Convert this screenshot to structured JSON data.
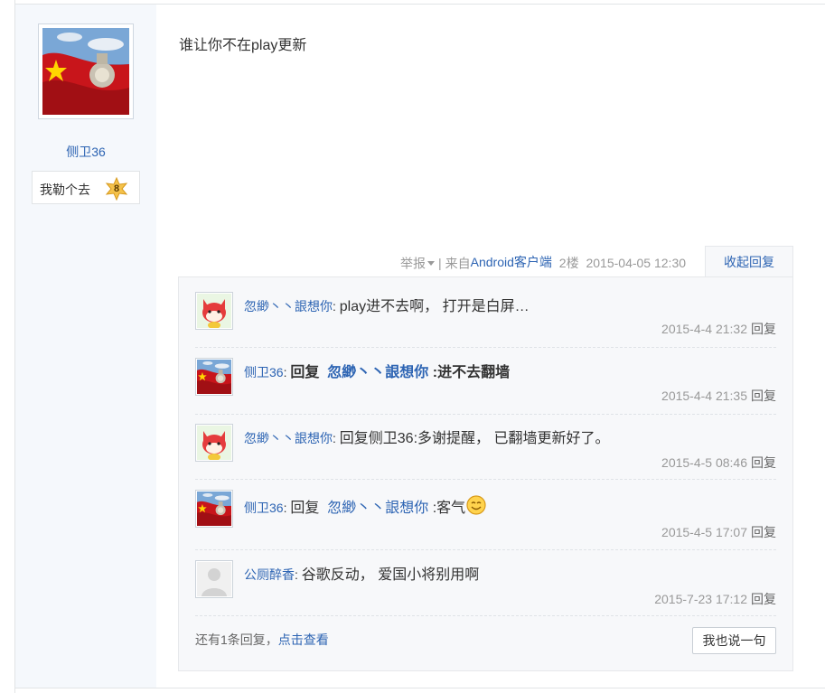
{
  "author": {
    "name": "侧卫36",
    "level_title": "我勒个去",
    "level": "8",
    "avatar": "chinese-flag-avatar"
  },
  "post": {
    "content": "谁让你不在play更新",
    "report_label": "举报",
    "from_prefix": "来自",
    "client": "Android客户端",
    "floor": "2楼",
    "time": "2015-04-05 12:30",
    "collapse_label": "收起回复"
  },
  "replies": [
    {
      "user": "忽緲丶丶詪想你",
      "avatar": "cartoon-fox-avatar",
      "text": "play进不去啊， 打开是白屏…",
      "time": "2015-4-4 21:32",
      "reply_label": "回复"
    },
    {
      "user": "侧卫36",
      "avatar": "chinese-flag-avatar",
      "prefix": "回复",
      "target": "忽緲丶丶詪想你",
      "text": ":进不去翻墙",
      "time": "2015-4-4 21:35",
      "reply_label": "回复"
    },
    {
      "user": "忽緲丶丶詪想你",
      "avatar": "cartoon-fox-avatar",
      "text": "回复侧卫36:多谢提醒， 已翻墙更新好了。",
      "time": "2015-4-5 08:46",
      "reply_label": "回复"
    },
    {
      "user": "侧卫36",
      "avatar": "chinese-flag-avatar",
      "prefix": "回复",
      "target": "忽緲丶丶詪想你",
      "text": ":客气",
      "emoji": "smiley-icon",
      "time": "2015-4-5 17:07",
      "reply_label": "回复"
    },
    {
      "user": "公厕醉香",
      "avatar": "default-user-avatar",
      "text": "谷歌反动， 爱国小将别用啊",
      "time": "2015-7-23 17:12",
      "reply_label": "回复"
    }
  ],
  "footer": {
    "more_text": "还有1条回复，",
    "more_link": "点击查看",
    "say_button": "我也说一句"
  },
  "colors": {
    "link": "#2d64b3",
    "muted": "#999999",
    "panel": "#f7f8fa",
    "sidebar": "#f5f8fc"
  }
}
